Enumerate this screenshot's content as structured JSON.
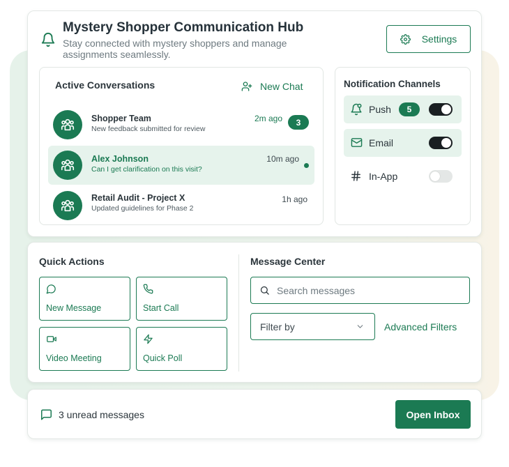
{
  "header": {
    "title": "Mystery Shopper Communication Hub",
    "subtitle": "Stay connected with mystery shoppers and manage assignments seamlessly.",
    "settings_label": "Settings",
    "icon": "bell-icon"
  },
  "conversations": {
    "title": "Active Conversations",
    "new_chat_label": "New Chat",
    "items": [
      {
        "name": "Shopper Team",
        "message": "New feedback submitted for review",
        "time": "2m ago",
        "unread_count": "3",
        "active": false
      },
      {
        "name": "Alex Johnson",
        "message": "Can I get clarification on this visit?",
        "time": "10m ago",
        "active": true,
        "unread_dot": true
      },
      {
        "name": "Retail Audit - Project X",
        "message": "Updated guidelines for Phase 2",
        "time": "1h ago",
        "active": false
      }
    ]
  },
  "notifications": {
    "title": "Notification Channels",
    "channels": [
      {
        "label": "Push",
        "badge": "5",
        "enabled": true,
        "icon": "bell-ring-icon"
      },
      {
        "label": "Email",
        "enabled": true,
        "icon": "mail-icon"
      },
      {
        "label": "In-App",
        "enabled": false,
        "icon": "hash-icon"
      }
    ]
  },
  "quick_actions": {
    "title": "Quick Actions",
    "items": [
      {
        "label": "New Message",
        "icon": "message-circle-icon"
      },
      {
        "label": "Start Call",
        "icon": "phone-icon"
      },
      {
        "label": "Video Meeting",
        "icon": "video-icon"
      },
      {
        "label": "Quick Poll",
        "icon": "zap-icon"
      }
    ]
  },
  "message_center": {
    "title": "Message Center",
    "search_placeholder": "Search messages",
    "filter_label": "Filter by",
    "advanced_filters_label": "Advanced Filters"
  },
  "footer": {
    "unread_text": "3 unread messages",
    "open_inbox_label": "Open Inbox"
  },
  "colors": {
    "accent": "#1b7a53",
    "active_row_bg": "#e6f3ec",
    "toggle_on": "#1a1f22"
  }
}
